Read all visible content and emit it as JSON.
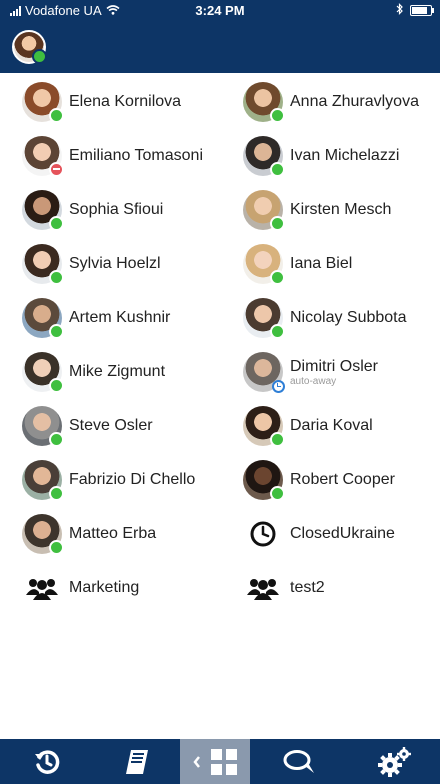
{
  "status_bar": {
    "carrier": "Vodafone UA",
    "time": "3:24 PM"
  },
  "colors": {
    "header": "#0d3566",
    "online": "#3fbf3f",
    "dnd": "#e5535b",
    "away": "#2f7fd6",
    "active_tab": "#8a99ad"
  },
  "contacts": [
    {
      "name": "Elena Kornilova",
      "presence": "online"
    },
    {
      "name": "Anna Zhuravlyova",
      "presence": "online"
    },
    {
      "name": "Emiliano Tomasoni",
      "presence": "dnd"
    },
    {
      "name": "Ivan Michelazzi",
      "presence": "online"
    },
    {
      "name": "Sophia Sfioui",
      "presence": "online"
    },
    {
      "name": "Kirsten Mesch",
      "presence": "online"
    },
    {
      "name": "Sylvia Hoelzl",
      "presence": "online"
    },
    {
      "name": "Iana Biel",
      "presence": "online"
    },
    {
      "name": "Artem Kushnir",
      "presence": "online"
    },
    {
      "name": "Nicolay Subbota",
      "presence": "online"
    },
    {
      "name": "Mike Zigmunt",
      "presence": "online"
    },
    {
      "name": "Dimitri Osler",
      "presence": "away",
      "status_text": "auto-away"
    },
    {
      "name": "Steve Osler",
      "presence": "online"
    },
    {
      "name": "Daria Koval",
      "presence": "online"
    },
    {
      "name": "Fabrizio Di Chello",
      "presence": "online"
    },
    {
      "name": "Robert Cooper",
      "presence": "online"
    },
    {
      "name": "Matteo Erba",
      "presence": "online"
    },
    {
      "name": "ClosedUkraine",
      "icon": "clock-icon"
    },
    {
      "name": "Marketing",
      "icon": "group-icon"
    },
    {
      "name": "test2",
      "icon": "group-icon"
    }
  ],
  "tabbar": {
    "items": [
      {
        "icon": "history-icon"
      },
      {
        "icon": "notebook-icon"
      },
      {
        "icon": "contacts-grid-icon",
        "active": true
      },
      {
        "icon": "chat-bubbles-icon"
      },
      {
        "icon": "settings-gears-icon"
      }
    ]
  }
}
